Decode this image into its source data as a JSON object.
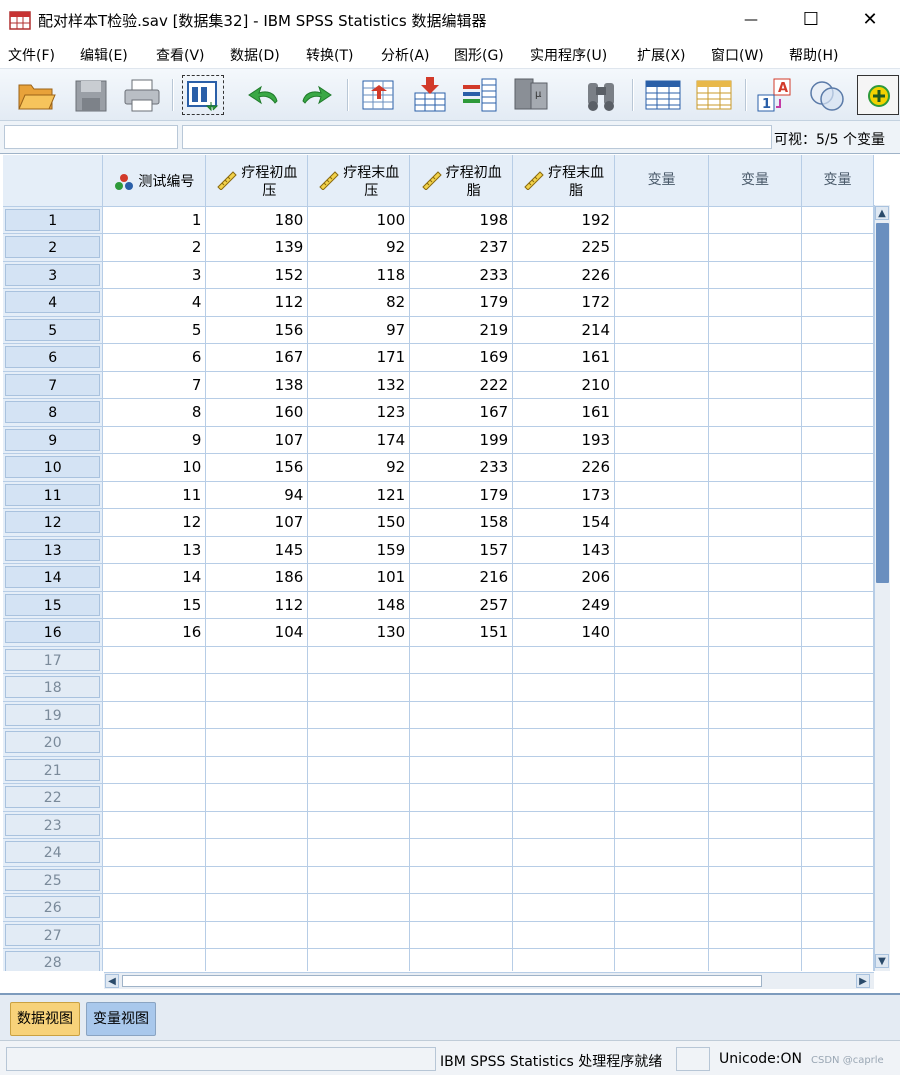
{
  "window": {
    "title": "配对样本T检验.sav [数据集32] - IBM SPSS Statistics 数据编辑器",
    "minimize": "—",
    "maximize": "☐",
    "close": "✕"
  },
  "menu": [
    "文件(F)",
    "编辑(E)",
    "查看(V)",
    "数据(D)",
    "转换(T)",
    "分析(A)",
    "图形(G)",
    "实用程序(U)",
    "扩展(X)",
    "窗口(W)",
    "帮助(H)"
  ],
  "toolbar": {
    "icons": [
      "open-folder-icon",
      "save-icon",
      "print-icon",
      "recall-dialog-icon",
      "undo-icon",
      "redo-icon",
      "goto-case-icon",
      "insert-cases-icon",
      "insert-variable-icon",
      "split-file-icon",
      "find-icon",
      "variables-icon",
      "select-cases-icon",
      "value-labels-icon",
      "use-sets-icon",
      "add-icon"
    ],
    "colors": {
      "green": "#2e9a3a",
      "blue": "#2a5fa8",
      "red": "#d23a2a"
    }
  },
  "editbar": {
    "cell_ref": "",
    "cell_value": "",
    "visible_label": "可视：5/5 个变量"
  },
  "grid": {
    "columns": [
      {
        "label_line1": "测试编号",
        "label_line2": "",
        "icon": "nominal-icon"
      },
      {
        "label_line1": "疗程初血",
        "label_line2": "压",
        "icon": "scale-ruler-icon"
      },
      {
        "label_line1": "疗程末血",
        "label_line2": "压",
        "icon": "scale-ruler-icon"
      },
      {
        "label_line1": "疗程初血",
        "label_line2": "脂",
        "icon": "scale-ruler-icon"
      },
      {
        "label_line1": "疗程末血",
        "label_line2": "脂",
        "icon": "scale-ruler-icon"
      }
    ],
    "empty_column_label": "变量",
    "row_numbers": [
      "1",
      "2",
      "3",
      "4",
      "5",
      "6",
      "7",
      "8",
      "9",
      "10",
      "11",
      "12",
      "13",
      "14",
      "15",
      "16",
      "17",
      "18",
      "19",
      "20",
      "21",
      "22",
      "23",
      "24",
      "25",
      "26",
      "27",
      "28"
    ],
    "rows": [
      [
        "1",
        "180",
        "100",
        "198",
        "192"
      ],
      [
        "2",
        "139",
        "92",
        "237",
        "225"
      ],
      [
        "3",
        "152",
        "118",
        "233",
        "226"
      ],
      [
        "4",
        "112",
        "82",
        "179",
        "172"
      ],
      [
        "5",
        "156",
        "97",
        "219",
        "214"
      ],
      [
        "6",
        "167",
        "171",
        "169",
        "161"
      ],
      [
        "7",
        "138",
        "132",
        "222",
        "210"
      ],
      [
        "8",
        "160",
        "123",
        "167",
        "161"
      ],
      [
        "9",
        "107",
        "174",
        "199",
        "193"
      ],
      [
        "10",
        "156",
        "92",
        "233",
        "226"
      ],
      [
        "11",
        "94",
        "121",
        "179",
        "173"
      ],
      [
        "12",
        "107",
        "150",
        "158",
        "154"
      ],
      [
        "13",
        "145",
        "159",
        "157",
        "143"
      ],
      [
        "14",
        "186",
        "101",
        "216",
        "206"
      ],
      [
        "15",
        "112",
        "148",
        "257",
        "249"
      ],
      [
        "16",
        "104",
        "130",
        "151",
        "140"
      ]
    ]
  },
  "tabs": {
    "data_view": "数据视图",
    "variable_view": "变量视图"
  },
  "status": {
    "processor": "IBM SPSS Statistics 处理程序就绪",
    "unicode": "Unicode:ON",
    "watermark": "CSDN @caprle"
  }
}
